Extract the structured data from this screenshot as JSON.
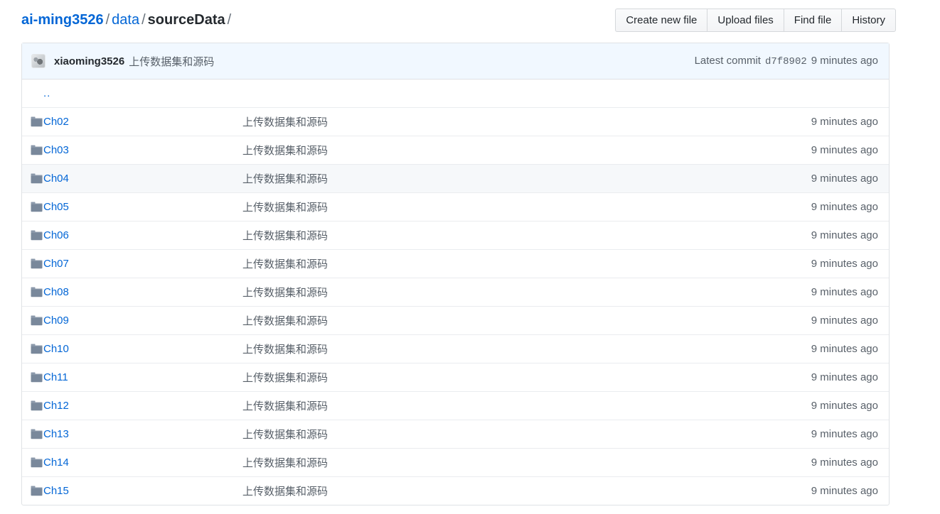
{
  "breadcrumb": {
    "owner": "ai-ming3526",
    "sep": "/",
    "path_link": "data",
    "current": "sourceData",
    "trailing_sep": "/"
  },
  "toolbar": {
    "buttons": [
      {
        "label": "Create new file",
        "name": "create-new-file-button"
      },
      {
        "label": "Upload files",
        "name": "upload-files-button"
      },
      {
        "label": "Find file",
        "name": "find-file-button"
      },
      {
        "label": "History",
        "name": "history-button"
      }
    ]
  },
  "commit": {
    "author": "xiaoming3526",
    "message": "上传数据集和源码",
    "latest_label": "Latest commit",
    "sha": "d7f8902",
    "age": "9 minutes ago",
    "avatar_icon": "user-avatar-icon"
  },
  "files": {
    "parent_dir_label": "..",
    "folder_icon": "folder-icon",
    "rows": [
      {
        "name": "Ch02",
        "message": "上传数据集和源码",
        "age": "9 minutes ago",
        "hovered": false
      },
      {
        "name": "Ch03",
        "message": "上传数据集和源码",
        "age": "9 minutes ago",
        "hovered": false
      },
      {
        "name": "Ch04",
        "message": "上传数据集和源码",
        "age": "9 minutes ago",
        "hovered": true
      },
      {
        "name": "Ch05",
        "message": "上传数据集和源码",
        "age": "9 minutes ago",
        "hovered": false
      },
      {
        "name": "Ch06",
        "message": "上传数据集和源码",
        "age": "9 minutes ago",
        "hovered": false
      },
      {
        "name": "Ch07",
        "message": "上传数据集和源码",
        "age": "9 minutes ago",
        "hovered": false
      },
      {
        "name": "Ch08",
        "message": "上传数据集和源码",
        "age": "9 minutes ago",
        "hovered": false
      },
      {
        "name": "Ch09",
        "message": "上传数据集和源码",
        "age": "9 minutes ago",
        "hovered": false
      },
      {
        "name": "Ch10",
        "message": "上传数据集和源码",
        "age": "9 minutes ago",
        "hovered": false
      },
      {
        "name": "Ch11",
        "message": "上传数据集和源码",
        "age": "9 minutes ago",
        "hovered": false
      },
      {
        "name": "Ch12",
        "message": "上传数据集和源码",
        "age": "9 minutes ago",
        "hovered": false
      },
      {
        "name": "Ch13",
        "message": "上传数据集和源码",
        "age": "9 minutes ago",
        "hovered": false
      },
      {
        "name": "Ch14",
        "message": "上传数据集和源码",
        "age": "9 minutes ago",
        "hovered": false
      },
      {
        "name": "Ch15",
        "message": "上传数据集和源码",
        "age": "9 minutes ago",
        "hovered": false
      }
    ]
  },
  "colors": {
    "link": "#0366d6",
    "text": "#24292e",
    "muted": "#586069",
    "border": "#dfe2e5",
    "row_border": "#eaecef",
    "commit_bar_bg": "#f1f8ff",
    "hover_bg": "#f6f8fa",
    "folder": "#79889b"
  }
}
